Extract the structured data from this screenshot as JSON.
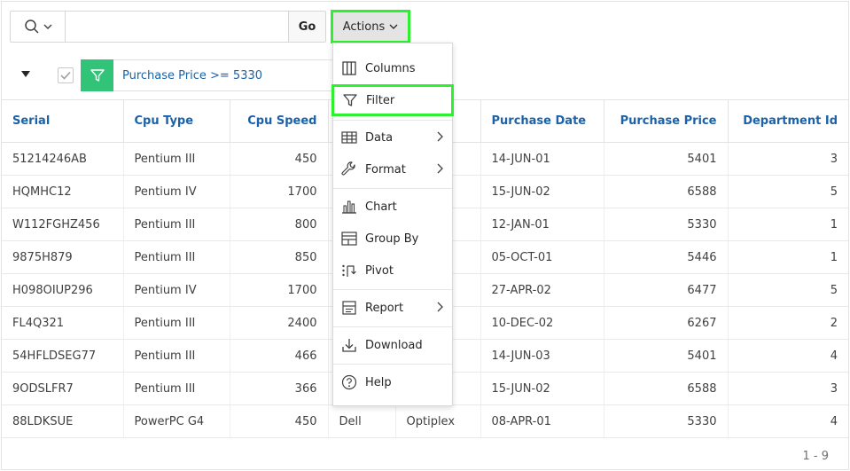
{
  "toolbar": {
    "search_placeholder": "",
    "go_label": "Go",
    "actions_label": "Actions"
  },
  "filter": {
    "text": "Purchase Price >= 5330"
  },
  "table": {
    "columns": [
      "Serial",
      "Cpu Type",
      "Cpu Speed",
      "",
      "",
      "Purchase Date",
      "Purchase Price",
      "Department Id"
    ],
    "rows": [
      [
        "51214246AB",
        "Pentium III",
        "450",
        "",
        "",
        "14-JUN-01",
        "5401",
        "3"
      ],
      [
        "HQMHC12",
        "Pentium IV",
        "1700",
        "",
        "",
        "15-JUN-02",
        "6588",
        "5"
      ],
      [
        "W112FGHZ456",
        "Pentium III",
        "800",
        "",
        "",
        "12-JAN-01",
        "5330",
        "1"
      ],
      [
        "9875H879",
        "Pentium III",
        "850",
        "",
        "",
        "05-OCT-01",
        "5446",
        "1"
      ],
      [
        "H098OIUP296",
        "Pentium IV",
        "1700",
        "",
        "",
        "27-APR-02",
        "6477",
        "5"
      ],
      [
        "FL4Q321",
        "Pentium III",
        "2400",
        "",
        "",
        "10-DEC-02",
        "6267",
        "2"
      ],
      [
        "54HFLDSEG77",
        "Pentium III",
        "466",
        "",
        "",
        "14-JUN-03",
        "5401",
        "4"
      ],
      [
        "9ODSLFR7",
        "Pentium III",
        "366",
        "",
        "",
        "15-JUN-02",
        "6588",
        "3"
      ],
      [
        "88LDKSUE",
        "PowerPC G4",
        "450",
        "Dell",
        "Optiplex",
        "08-APR-01",
        "5330",
        "4"
      ]
    ]
  },
  "pagination": "1 - 9",
  "menu": {
    "items": [
      {
        "label": "Columns",
        "icon": "columns-icon"
      },
      {
        "label": "Filter",
        "icon": "filter-icon"
      },
      {
        "label": "Data",
        "icon": "data-icon"
      },
      {
        "label": "Format",
        "icon": "wrench-icon"
      },
      {
        "label": "Chart",
        "icon": "bar-chart-icon"
      },
      {
        "label": "Group By",
        "icon": "group-by-icon"
      },
      {
        "label": "Pivot",
        "icon": "pivot-icon"
      },
      {
        "label": "Report",
        "icon": "report-icon"
      },
      {
        "label": "Download",
        "icon": "download-icon"
      },
      {
        "label": "Help",
        "icon": "help-icon"
      }
    ]
  },
  "colors": {
    "link_blue": "#1b62a8",
    "filter_green": "#31c377",
    "highlight_green": "#2ef02e"
  }
}
